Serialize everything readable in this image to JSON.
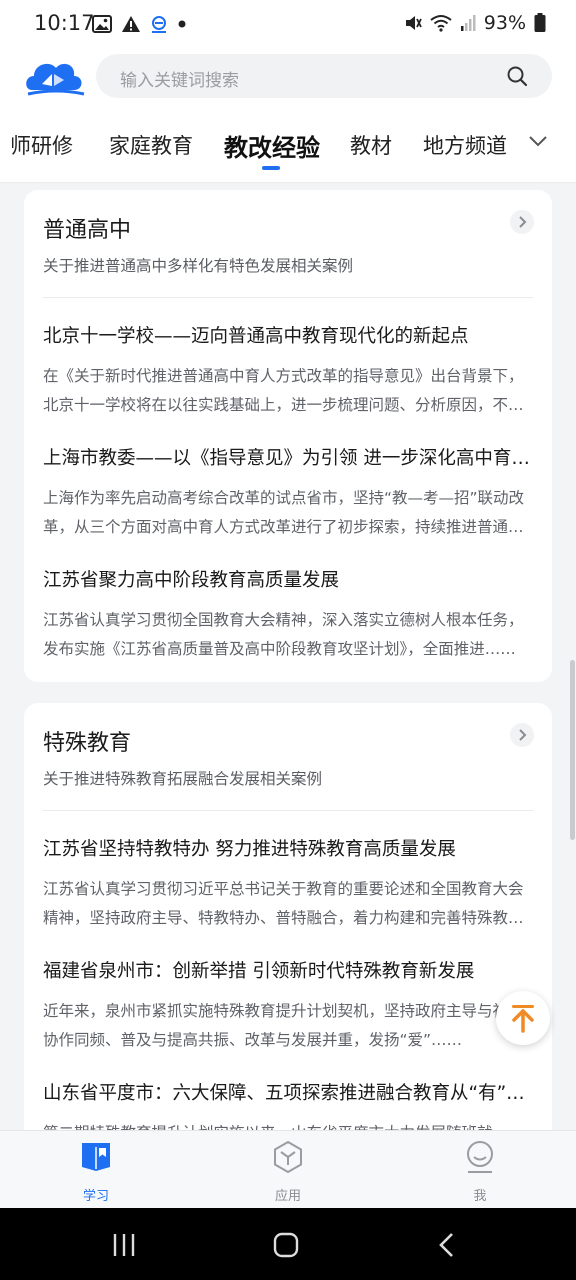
{
  "status_bar": {
    "time": "10:17",
    "battery": "93%",
    "left_icons": [
      "image-icon",
      "alert-icon",
      "sync-icon",
      "dot-icon"
    ],
    "right_icons": [
      "mute-icon",
      "wifi-icon",
      "signal-icon",
      "battery-icon"
    ]
  },
  "header": {
    "logo": "cloud-logo",
    "search": {
      "placeholder": "输入关键词搜索",
      "icon": "search-icon"
    }
  },
  "tabs": {
    "items": [
      "师研修",
      "家庭教育",
      "教改经验",
      "教材",
      "地方频道"
    ],
    "active": "教改经验",
    "more_icon": "chevron-down-icon",
    "accent": "#1f6ff2"
  },
  "sections": [
    {
      "title": "普通高中",
      "subtitle": "关于推进普通高中多样化有特色发展相关案例",
      "articles": [
        {
          "title": "北京十一学校——迈向普通高中教育现代化的新起点",
          "summary": "在《关于新时代推进普通高中育人方式改革的指导意见》出台背景下，北京十一学校将在以往实践基础上，进一步梳理问题、分析原因，不断深化改革……"
        },
        {
          "title": "上海市教委——以《指导意见》为引领 进一步深化高中育人方式改革",
          "summary": "上海作为率先启动高考综合改革的试点省市，坚持“教—考—招”联动改革，从三个方面对高中育人方式改革进行了初步探索，持续推进普通高中育人方式改革……"
        },
        {
          "title": "江苏省聚力高中阶段教育高质量发展",
          "summary": "江苏省认真学习贯彻全国教育大会精神，深入落实立德树人根本任务，发布实施《江苏省高质量普及高中阶段教育攻坚计划》，全面推进……"
        }
      ]
    },
    {
      "title": "特殊教育",
      "subtitle": "关于推进特殊教育拓展融合发展相关案例",
      "articles": [
        {
          "title": "江苏省坚持特教特办 努力推进特殊教育高质量发展",
          "summary": "江苏省认真学习贯彻习近平总书记关于教育的重要论述和全国教育大会精神，坚持政府主导、特教特办、普特融合，着力构建和完善特殊教育体系……"
        },
        {
          "title": "福建省泉州市：创新举措 引领新时代特殊教育新发展",
          "summary": "近年来，泉州市紧抓实施特殊教育提升计划契机，坚持政府主导与社会协作同频、普及与提高共振、改革与发展并重，发扬“爱”……"
        },
        {
          "title": "山东省平度市：六大保障、五项探索推进融合教育从“有”到“优”",
          "summary": "第二期特殊教育提升计划实施以来，山东省平度市大力发展随班就读……"
        }
      ]
    }
  ],
  "back_to_top_icon": "arrow-up-icon",
  "bottom_nav": [
    {
      "label": "学习",
      "icon": "book-icon",
      "active": true
    },
    {
      "label": "应用",
      "icon": "hexagon-app-icon",
      "active": false
    },
    {
      "label": "我",
      "icon": "user-icon",
      "active": false
    }
  ],
  "system_nav": [
    "recents-icon",
    "home-icon",
    "back-icon"
  ]
}
